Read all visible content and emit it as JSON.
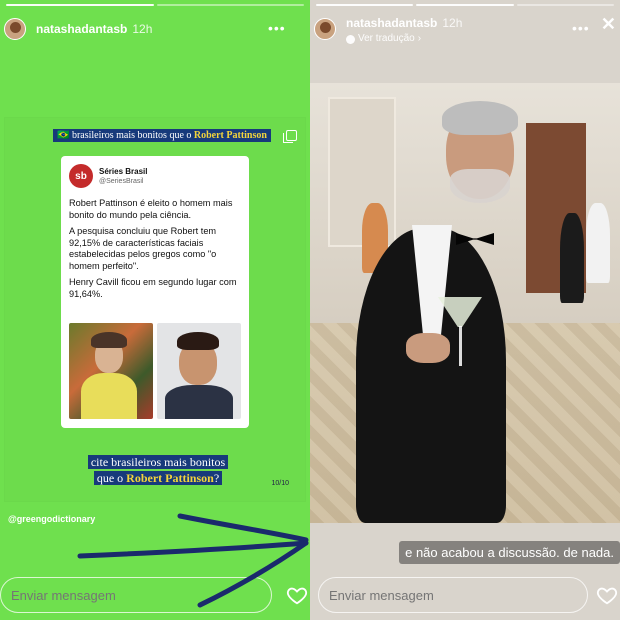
{
  "left_story": {
    "username": "natashadantasb",
    "time": "12h",
    "more_label": "•••",
    "post": {
      "heading_prefix": "🇧🇷 brasileiros mais bonitos que o ",
      "heading_highlight": "Robert Pattinson",
      "tweet": {
        "logo_text": "sb",
        "account_name": "Séries Brasil",
        "account_handle": "@SeriesBrasil",
        "paragraphs": [
          "Robert Pattinson é eleito o homem mais bonito do mundo pela ciência.",
          "A pesquisa concluiu que Robert tem 92,15% de características faciais estabelecidas pelos gregos como \"o homem perfeito\".",
          "Henry Cavill ficou em segundo lugar com 91,64%."
        ]
      },
      "caption_line1": "cite brasileiros mais bonitos",
      "caption_line2_prefix": "que o ",
      "caption_line2_highlight": "Robert Pattinson",
      "caption_line2_suffix": "?",
      "page_count": "10/10"
    },
    "mention": "@greengodictionary",
    "message_placeholder": "Enviar mensagem"
  },
  "right_story": {
    "username": "natashadantasb",
    "time": "12h",
    "translate_label": "Ver tradução",
    "more_label": "•••",
    "close_label": "✕",
    "caption": "e não acabou a discussão.  de nada.",
    "message_placeholder": "Enviar mensagem"
  },
  "colors": {
    "left_bg": "#6fe04e",
    "highlight_bg": "#173a7b",
    "highlight_text": "#f3d43c",
    "arrow": "#1a2a6c"
  },
  "icons": [
    "more-icon",
    "close-icon",
    "globe-icon",
    "copy-icon",
    "heart-icon",
    "arrow-drawing"
  ]
}
